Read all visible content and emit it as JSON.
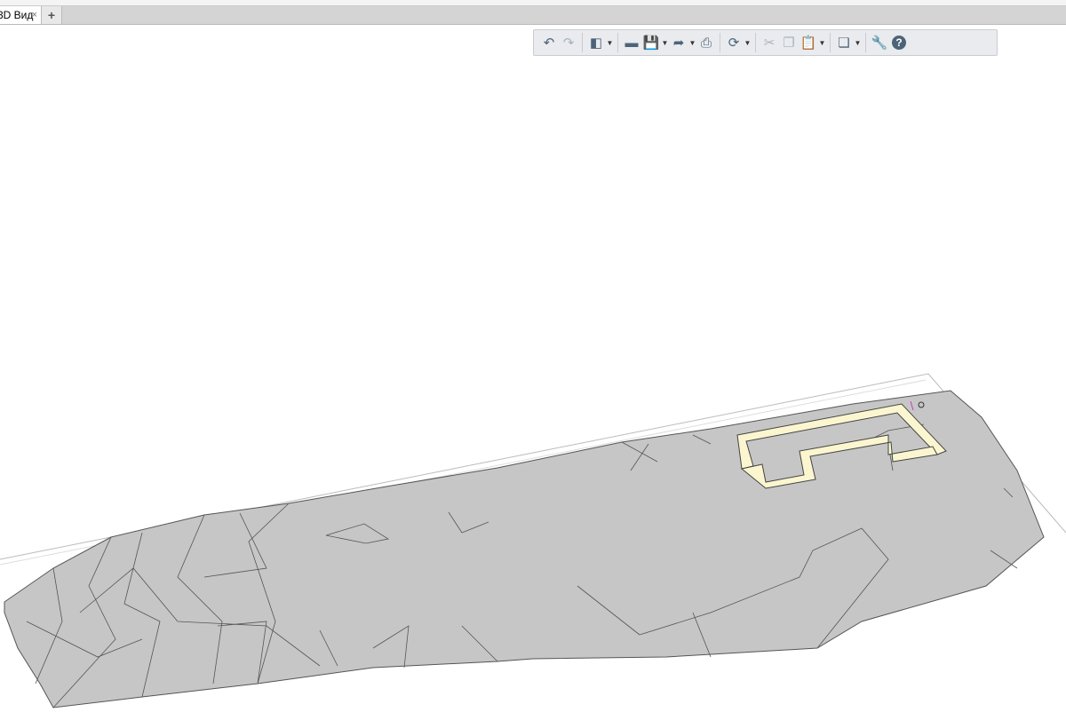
{
  "tabs": [
    {
      "label": "3D Вид",
      "close": "×"
    }
  ],
  "add_tab": "+",
  "toolbar": {
    "items": [
      {
        "icon": "undo-icon",
        "glyph": "↶",
        "enabled": true
      },
      {
        "icon": "redo-icon",
        "glyph": "↷",
        "enabled": false
      },
      {
        "icon": "3d-box-icon",
        "glyph": "◧",
        "dropdown": true
      },
      {
        "icon": "open-folder-icon",
        "glyph": "▬"
      },
      {
        "icon": "save-icon",
        "glyph": "💾",
        "dropdown": true
      },
      {
        "icon": "export-icon",
        "glyph": "➦",
        "dropdown": true
      },
      {
        "icon": "print-icon",
        "glyph": "⎙"
      },
      {
        "icon": "sync-cloud-icon",
        "glyph": "⟳",
        "dropdown": true
      },
      {
        "icon": "cut-icon",
        "glyph": "✂",
        "enabled": false
      },
      {
        "icon": "copy-icon",
        "glyph": "❐",
        "enabled": false
      },
      {
        "icon": "paste-icon",
        "glyph": "📋",
        "enabled": false,
        "dropdown": true
      },
      {
        "icon": "views-icon",
        "glyph": "❏",
        "dropdown": true
      },
      {
        "icon": "settings-wrench-icon",
        "glyph": "🔧"
      },
      {
        "icon": "help-icon",
        "glyph": "?"
      }
    ]
  },
  "colors": {
    "terrain": "#c6c6c6",
    "terrain_edges": "#555555",
    "building": "#fbf6cf",
    "toolbar_icon": "#4d6478"
  }
}
